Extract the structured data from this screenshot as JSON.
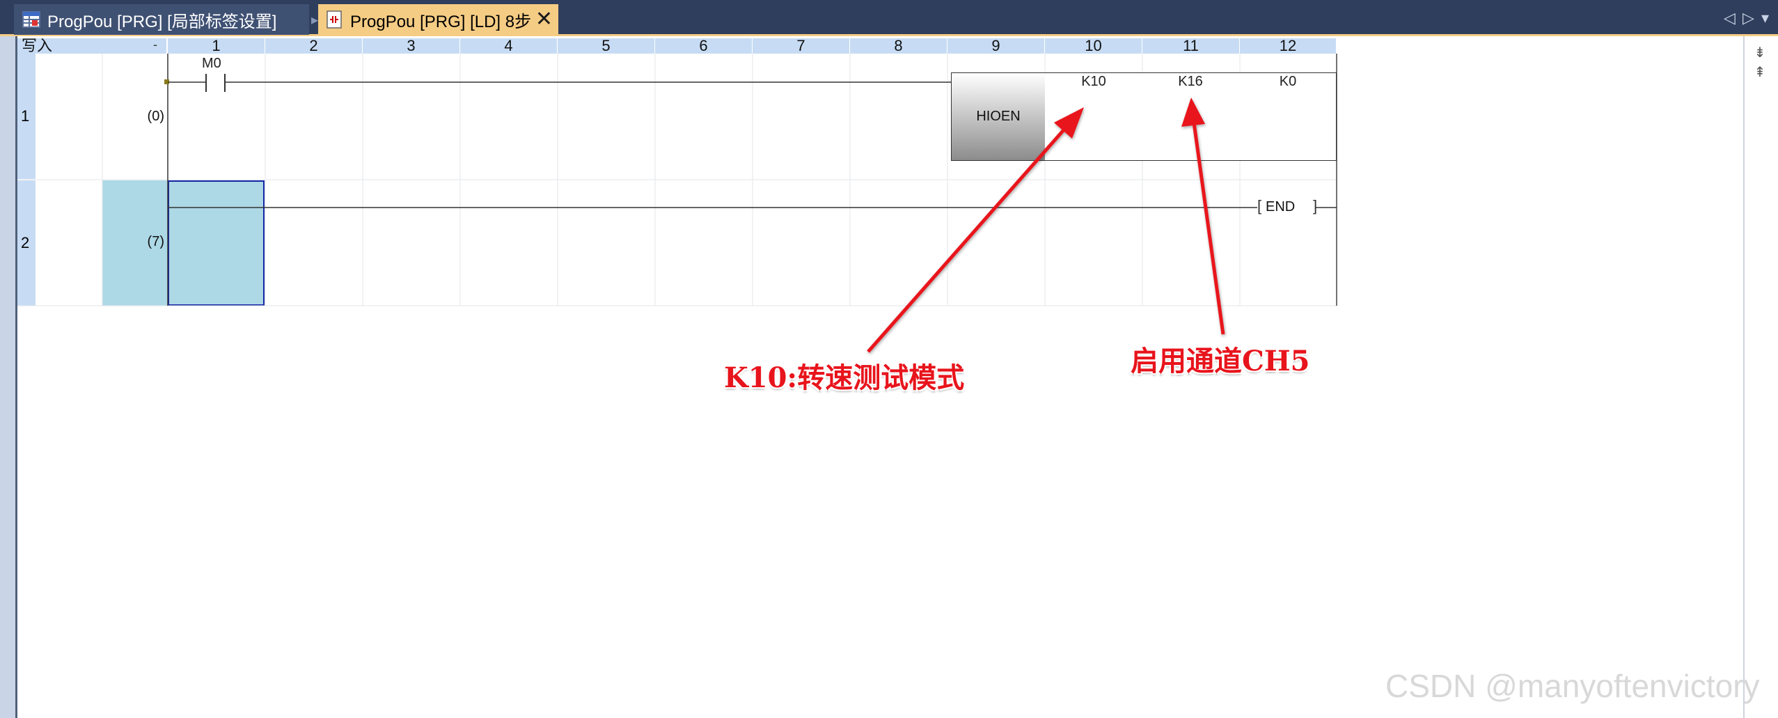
{
  "tabs": [
    {
      "label": "ProgPou [PRG] [局部标签设置]",
      "icon": "table-icon",
      "active": false
    },
    {
      "label": "ProgPou [PRG] [LD] 8步",
      "icon": "ladder-icon",
      "active": true
    }
  ],
  "tab_close": "✕",
  "nav": {
    "left": "◁",
    "right": "▷",
    "menu": "▾"
  },
  "ladder": {
    "mode_label": "写入",
    "header_dot": "-",
    "columns": [
      "1",
      "2",
      "3",
      "4",
      "5",
      "6",
      "7",
      "8",
      "9",
      "10",
      "11",
      "12"
    ],
    "rows": [
      {
        "num": "1",
        "step": "(0)"
      },
      {
        "num": "2",
        "step": "(7)"
      }
    ],
    "contact": "M0",
    "instruction": "HIOEN",
    "operands": [
      "K10",
      "K16",
      "K0"
    ],
    "end": "END",
    "end_open": "[",
    "end_close": "]"
  },
  "annotations": {
    "mode": "K10:转速测试模式",
    "channel": "启用通道CH5"
  },
  "watermark": "CSDN @manyoftenvictory",
  "colors": {
    "tabbar": "#2f3e5c",
    "active_tab": "#f5cc84",
    "header": "#c7dcf4",
    "selection": "#add8e6",
    "arrow": "#e8141c"
  }
}
